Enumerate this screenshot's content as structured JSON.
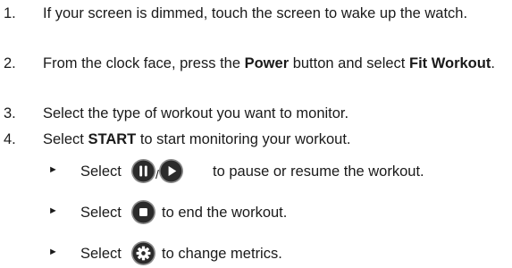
{
  "steps": [
    {
      "number": "1.",
      "text_before": "If your screen is dimmed, touch the screen to wake up the watch.",
      "bold": "",
      "text_middle": "",
      "bold2": "",
      "text_after": ""
    },
    {
      "number": "2.",
      "text_before": "From the clock face, press the ",
      "bold": "Power",
      "text_middle": " button and select ",
      "bold2": "Fit Workout",
      "text_after": "."
    },
    {
      "number": "3.",
      "text_before": "Select the type of workout you want to monitor.",
      "bold": "",
      "text_middle": "",
      "bold2": "",
      "text_after": ""
    },
    {
      "number": "4.",
      "text_before": "Select ",
      "bold": "START",
      "text_middle": " to start monitoring your workout.",
      "bold2": "",
      "text_after": ""
    }
  ],
  "substeps": [
    {
      "bullet": "►",
      "word": "Select",
      "slash": "/",
      "icons": [
        "pause-icon",
        "play-icon"
      ],
      "after": "to pause or resume the workout."
    },
    {
      "bullet": "►",
      "word": "Select",
      "icons": [
        "stop-icon"
      ],
      "after": "to end the workout."
    },
    {
      "bullet": "►",
      "word": "Select",
      "icons": [
        "settings-gear-icon"
      ],
      "after": "to change metrics."
    }
  ],
  "colors": {
    "text": "#1a1a1a",
    "icon_fill": "#2b2b2b",
    "icon_ring": "#8a8a8a"
  }
}
